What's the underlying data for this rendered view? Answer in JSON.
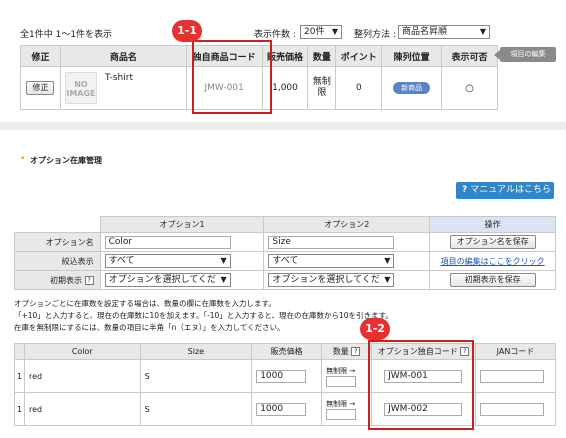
{
  "top": {
    "count_text": "全1件中 1〜1件を表示",
    "per_page_label": "表示件数 :",
    "per_page_value": "20件",
    "sort_label": "整列方法 :",
    "sort_value": "商品名昇順",
    "edit_items_tab": "項目の編集"
  },
  "product_table": {
    "headers": [
      "修正",
      "商品名",
      "独自商品コード",
      "販売価格",
      "数量",
      "ポイント",
      "陳列位置",
      "表示可否"
    ],
    "row": {
      "edit_button": "修正",
      "noimage_line1": "NO",
      "noimage_line2": "IMAGE",
      "name": "T-shirt",
      "code": "JMW-001",
      "price": "1,000",
      "qty_line1": "無制",
      "qty_line2": "限",
      "points": "0",
      "position_badge": "新商品",
      "visible": "○"
    }
  },
  "badges": {
    "b1": "1-1",
    "b2": "1-2"
  },
  "section": {
    "title": "オプション在庫管理",
    "manual_button": "マニュアルはこちら"
  },
  "option_table": {
    "headers": [
      "オプション1",
      "オプション2",
      "操作"
    ],
    "row_name": {
      "label": "オプション名",
      "opt1": "Color",
      "opt2": "Size",
      "action": "オプション名を保存"
    },
    "row_filter": {
      "label": "絞込表示",
      "opt1": "すべて",
      "opt2": "すべて",
      "action": "項目の編集はここをクリック"
    },
    "row_initial": {
      "label": "初期表示",
      "opt1": "オプションを選択してくだ",
      "opt2": "オプションを選択してくだ",
      "action": "初期表示を保存"
    }
  },
  "info_lines": [
    "オプションごとに在庫数を設定する場合は、数量の欄に在庫数を入力します。",
    "「+10」と入力すると、現在の在庫数に10を加えます。「-10」と入力すると、現在の在庫数から10を引きます。",
    "在庫を無制限にするには、数量の項目に半角「n（エヌ）」を入力してください。"
  ],
  "inventory_table": {
    "headers": [
      "Color",
      "Size",
      "販売価格",
      "数量",
      "オプション独自コード",
      "JANコード"
    ],
    "rows": [
      {
        "num": "1",
        "color": "red",
        "size": "S",
        "price": "1000",
        "qty_label": "無制限 →",
        "code": "JWM-001"
      },
      {
        "num": "1",
        "color": "red",
        "size": "S",
        "price": "1000",
        "qty_label": "無制限 →",
        "code": "JWM-002"
      }
    ]
  }
}
